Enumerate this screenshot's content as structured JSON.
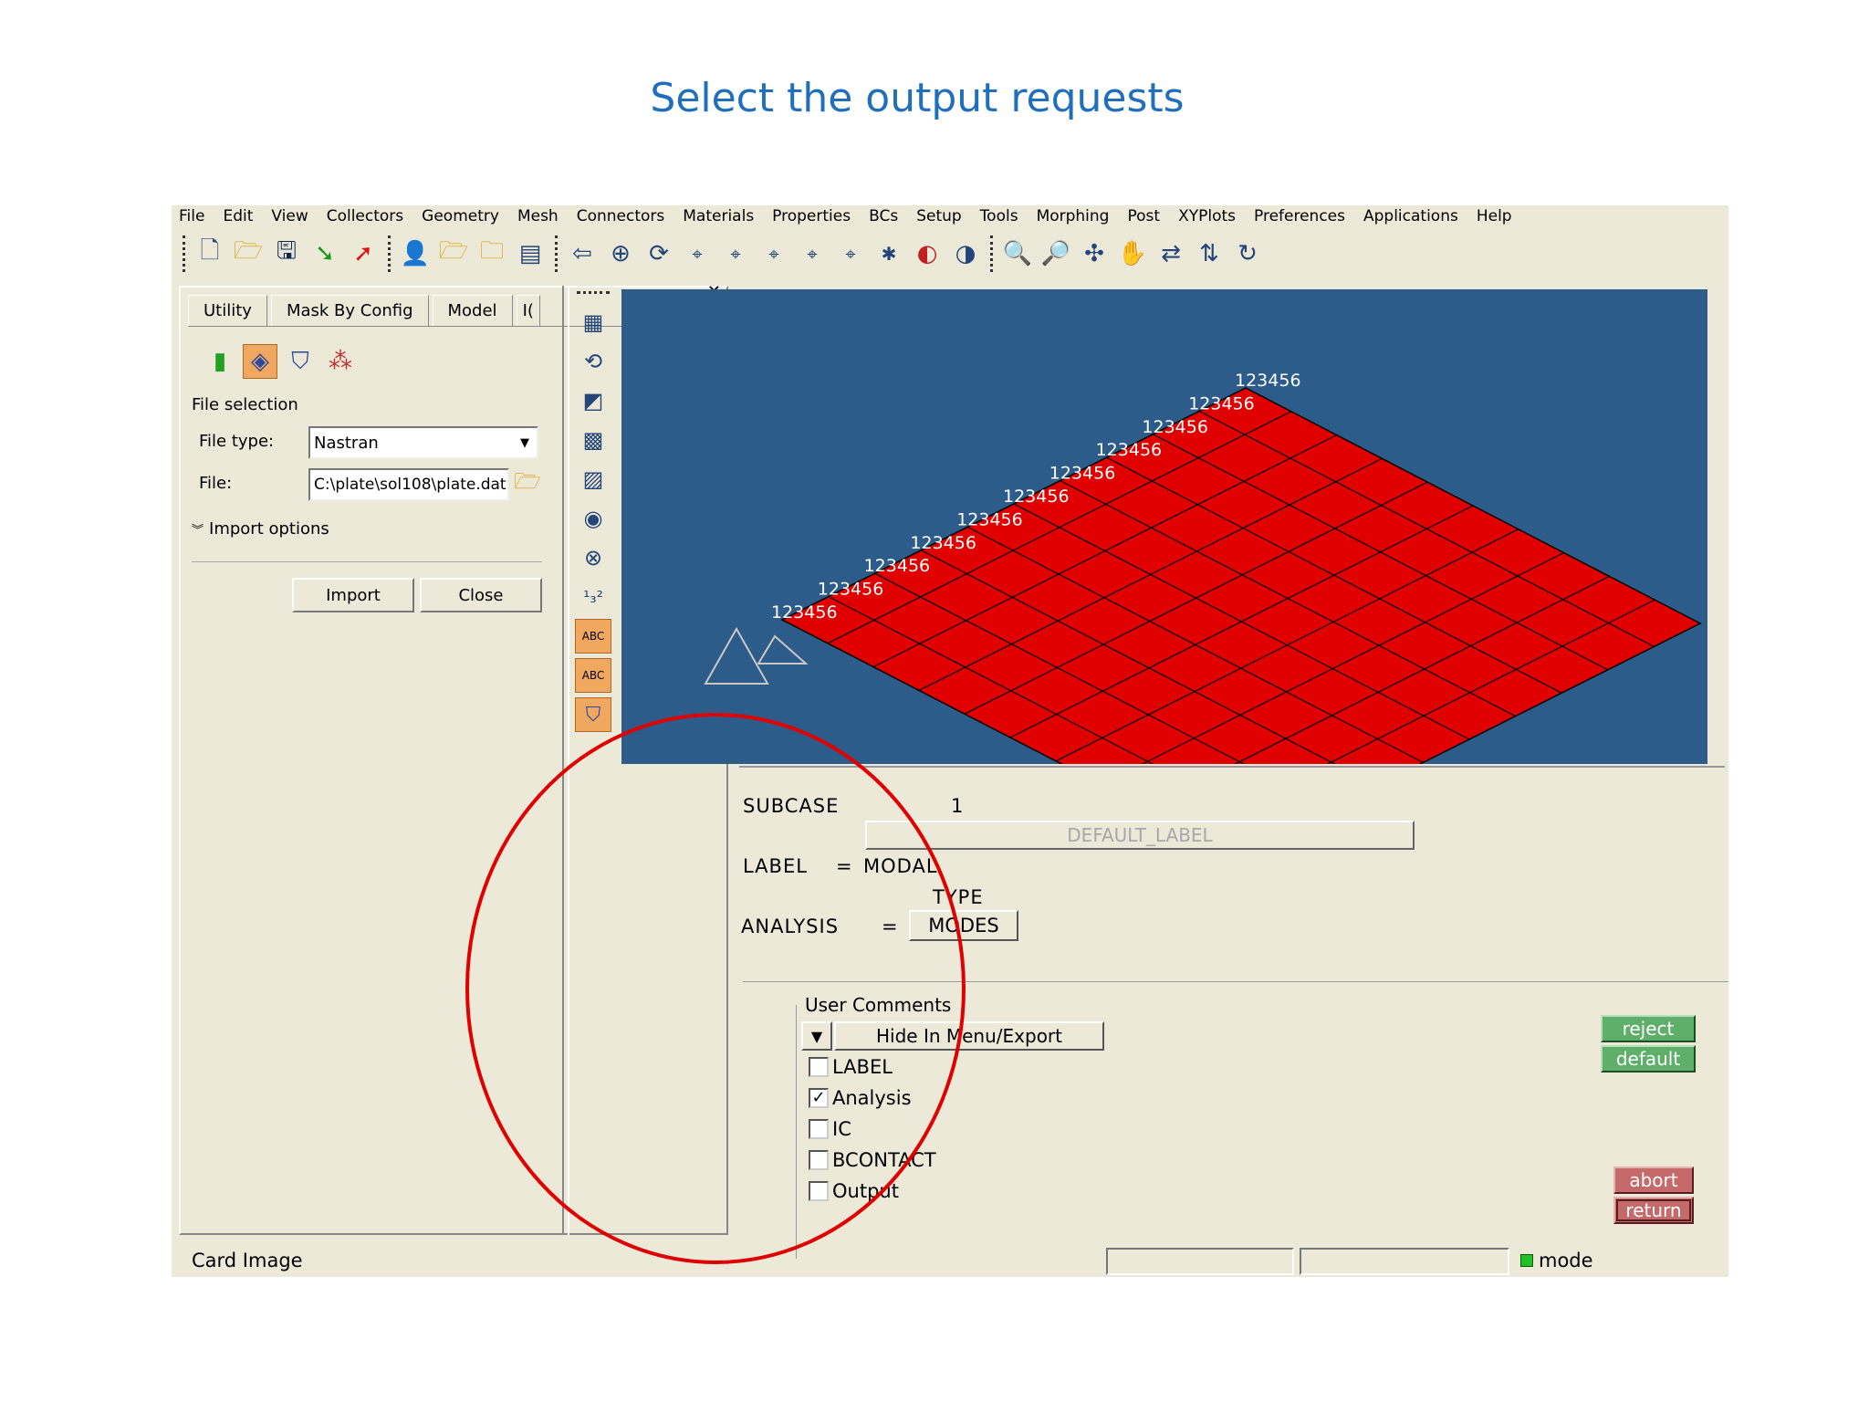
{
  "slide": {
    "title": "Select the output requests"
  },
  "menu": [
    "File",
    "Edit",
    "View",
    "Collectors",
    "Geometry",
    "Mesh",
    "Connectors",
    "Materials",
    "Properties",
    "BCs",
    "Setup",
    "Tools",
    "Morphing",
    "Post",
    "XYPlots",
    "Preferences",
    "Applications",
    "Help"
  ],
  "tabs": [
    "Utility",
    "Mask By Config",
    "Model",
    "I("
  ],
  "panel": {
    "file_selection": "File selection",
    "file_type_label": "File type:",
    "file_type_value": "Nastran",
    "file_label": "File:",
    "file_value": "C:\\plate\\sol108\\plate.dat",
    "import_options": "Import options",
    "import_button": "Import",
    "close_button": "Close"
  },
  "vtoolbar": {
    "abc_label_1": "ABC",
    "abc_label_2": "ABC"
  },
  "viewport": {
    "bg_color": "#2e5c8a",
    "mesh_color": "#e00000",
    "constraint_labels": [
      "123456",
      "123456",
      "123456",
      "123456",
      "123456",
      "123456",
      "123456",
      "123456",
      "123456",
      "123456",
      "123456"
    ]
  },
  "card": {
    "subcase_label": "SUBCASE",
    "subcase_value": "1",
    "default_label": "DEFAULT_LABEL",
    "label_key": "LABEL",
    "equals": "=",
    "label_value": "MODAL",
    "type_label": "TYPE",
    "analysis_key": "ANALYSIS",
    "analysis_value": "MODES",
    "user_comments": "User Comments",
    "hide_in_menu": "Hide In Menu/Export",
    "options": [
      {
        "label": "LABEL",
        "checked": false
      },
      {
        "label": "Analysis",
        "checked": true
      },
      {
        "label": "IC",
        "checked": false
      },
      {
        "label": "BCONTACT",
        "checked": false
      },
      {
        "label": "Output",
        "checked": false
      }
    ],
    "reject": "reject",
    "default": "default",
    "abort": "abort",
    "return": "return"
  },
  "status": {
    "text": "Card Image",
    "mode": "mode"
  },
  "annotation": {
    "circle_color": "#e00000"
  }
}
